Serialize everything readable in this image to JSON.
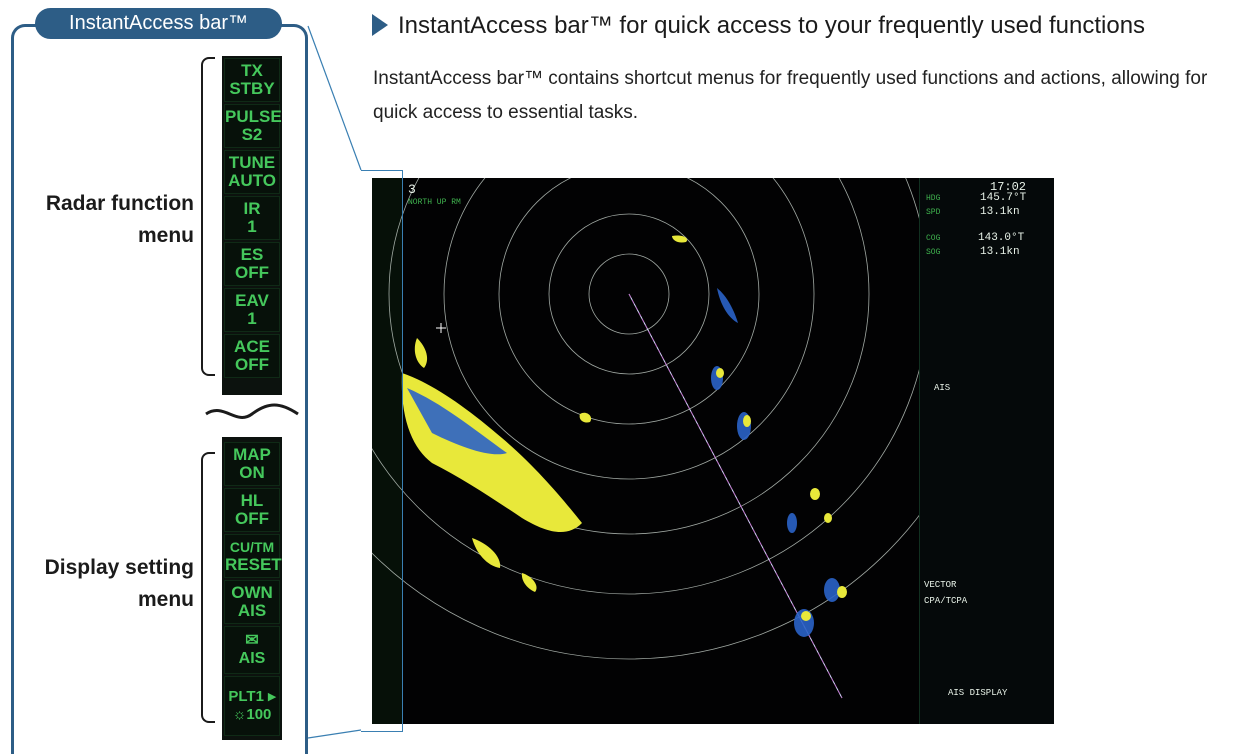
{
  "callout": {
    "title": "InstantAccess bar™",
    "radar_menu_label": [
      "Radar function",
      "menu"
    ],
    "display_menu_label": [
      "Display setting",
      "menu"
    ]
  },
  "bar_buttons_radar": [
    {
      "line1": "TX",
      "line2": "STBY"
    },
    {
      "line1": "PULSE",
      "line2": "S2"
    },
    {
      "line1": "TUNE",
      "line2": "AUTO"
    },
    {
      "line1": "IR",
      "line2": "1"
    },
    {
      "line1": "ES",
      "line2": "OFF"
    },
    {
      "line1": "EAV",
      "line2": "1"
    },
    {
      "line1": "ACE",
      "line2": "OFF"
    }
  ],
  "bar_buttons_display": [
    {
      "line1": "MAP",
      "line2": "ON"
    },
    {
      "line1": "HL",
      "line2": "OFF"
    },
    {
      "line1": "CU/TM",
      "line2": "RESET"
    },
    {
      "line1": "OWN",
      "line2": "AIS"
    },
    {
      "line1": "✉",
      "line2": "AIS"
    },
    {
      "line1": "PLT1 ▸",
      "line2": "☼100"
    }
  ],
  "heading": "InstantAccess bar™ for quick access to your frequently used functions",
  "description": "InstantAccess bar™ contains shortcut menus for frequently used functions and actions, allowing for quick access to essential tasks.",
  "radar_screen": {
    "range": "3",
    "time": "17:02",
    "heading_mode": "NORTH UP RM",
    "hdg": "145.7°T",
    "spd": "13.1kn",
    "cog": "143.0°T",
    "sog": "13.1kn",
    "panel_header": "AIS",
    "vector": "VECTOR",
    "cpa": "CPA/TCPA",
    "ais_display": "AIS DISPLAY",
    "colors": {
      "echo": "#e8e83a",
      "trail": "#2b63c8",
      "ring": "#c9d3cc",
      "text": "#3fb24e"
    }
  }
}
